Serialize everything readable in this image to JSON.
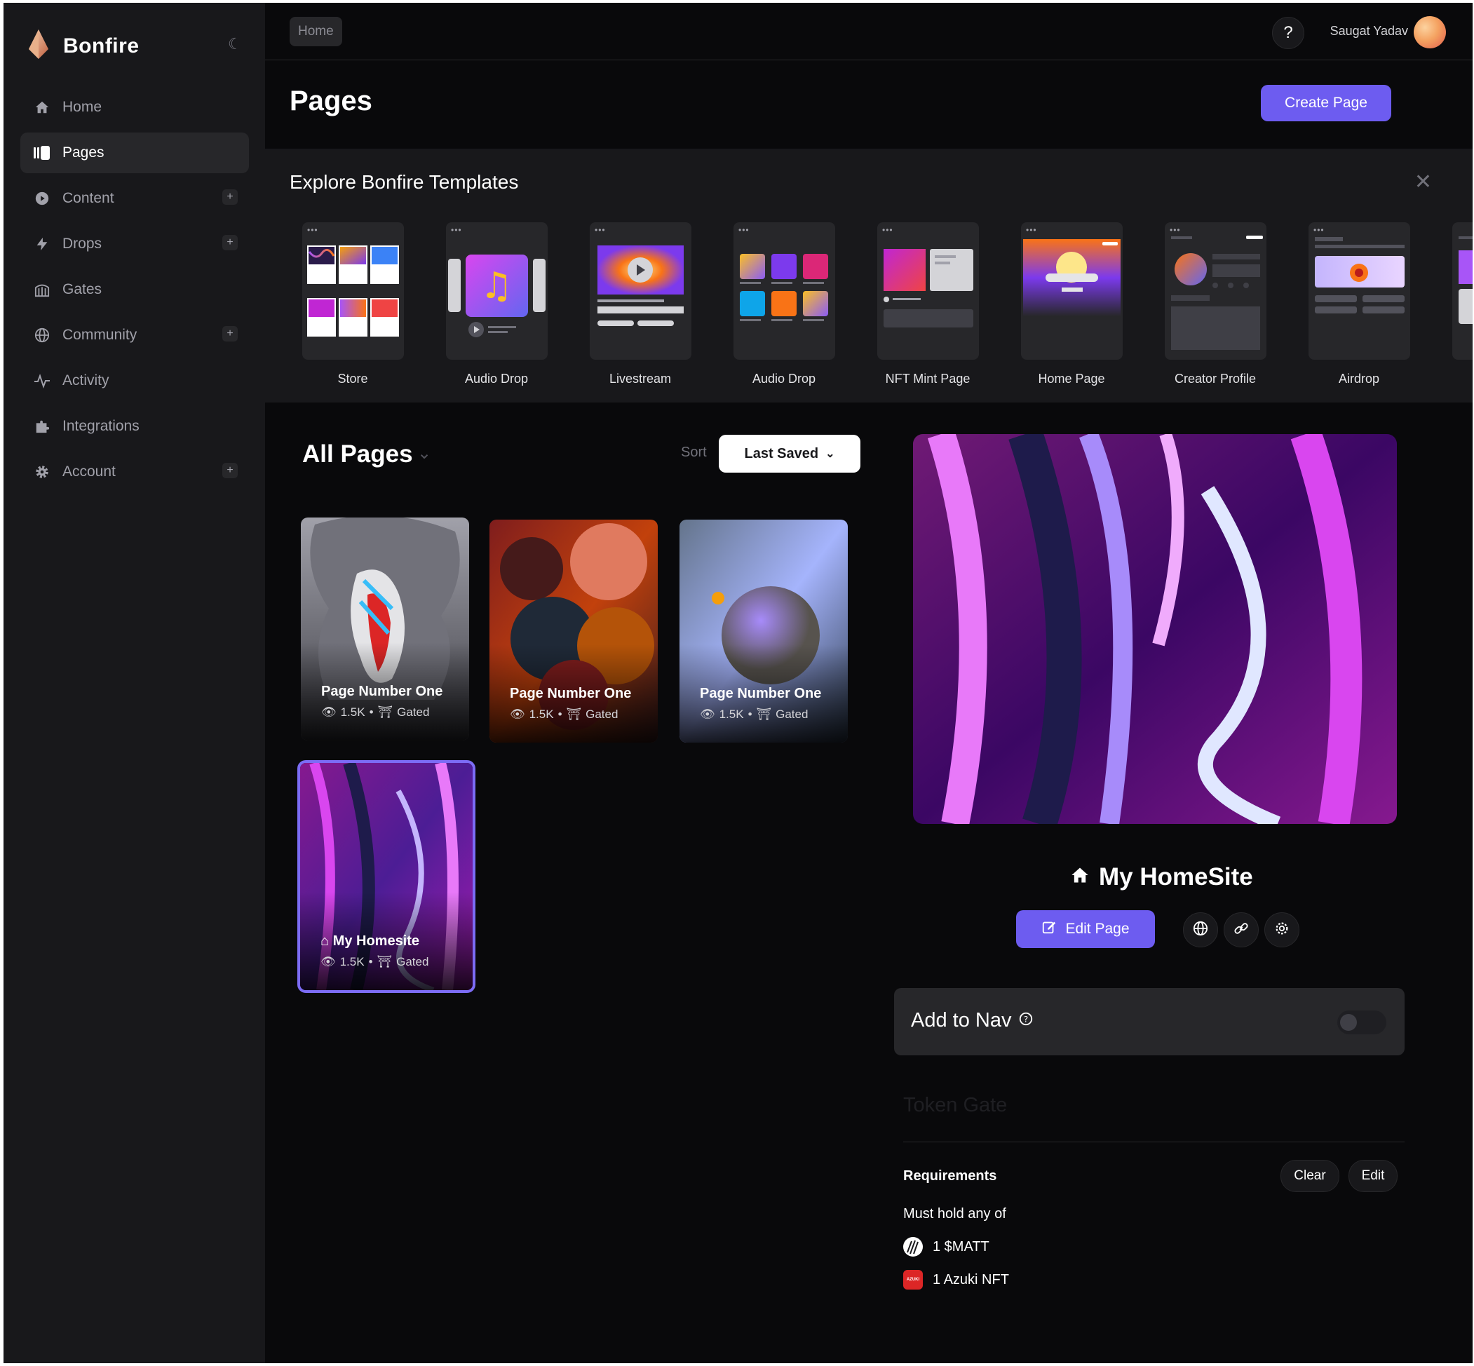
{
  "app": {
    "brand": "Bonfire"
  },
  "sidebar": {
    "items": [
      {
        "label": "Home",
        "icon": "home-icon",
        "active": false,
        "plus": false
      },
      {
        "label": "Pages",
        "icon": "pages-icon",
        "active": true,
        "plus": false
      },
      {
        "label": "Content",
        "icon": "play-circle-icon",
        "active": false,
        "plus": true
      },
      {
        "label": "Drops",
        "icon": "lightning-icon",
        "active": false,
        "plus": true
      },
      {
        "label": "Gates",
        "icon": "gate-icon",
        "active": false,
        "plus": false
      },
      {
        "label": "Community",
        "icon": "globe-icon",
        "active": false,
        "plus": true
      },
      {
        "label": "Activity",
        "icon": "activity-icon",
        "active": false,
        "plus": false
      },
      {
        "label": "Integrations",
        "icon": "puzzle-icon",
        "active": false,
        "plus": false
      },
      {
        "label": "Account",
        "icon": "gear-icon",
        "active": false,
        "plus": true
      }
    ],
    "plus_symbol": "+"
  },
  "topbar": {
    "breadcrumb": "Home",
    "help": "?",
    "user_name": "Saugat Yadav"
  },
  "header": {
    "title": "Pages",
    "create_label": "Create Page"
  },
  "templates": {
    "title": "Explore Bonfire Templates",
    "items": [
      {
        "label": "Store"
      },
      {
        "label": "Audio Drop"
      },
      {
        "label": "Livestream"
      },
      {
        "label": "Audio Drop"
      },
      {
        "label": "NFT Mint Page"
      },
      {
        "label": "Home Page"
      },
      {
        "label": "Creator Profile"
      },
      {
        "label": "Airdrop"
      }
    ]
  },
  "all_pages": {
    "title": "All Pages",
    "sort_label": "Sort",
    "sort_value": "Last Saved",
    "cards": [
      {
        "title": "Page Number One",
        "views": "1.5K",
        "status": "Gated"
      },
      {
        "title": "Page Number One",
        "views": "1.5K",
        "status": "Gated"
      },
      {
        "title": "Page Number One",
        "views": "1.5K",
        "status": "Gated"
      },
      {
        "title": "My Homesite",
        "views": "1.5K",
        "status": "Gated",
        "selected": true
      }
    ]
  },
  "detail": {
    "name": "My HomeSite",
    "edit_label": "Edit Page",
    "add_to_nav_label": "Add to Nav",
    "add_to_nav_on": false,
    "token_gate_label": "Token Gate",
    "requirements_label": "Requirements",
    "clear_label": "Clear",
    "edit_req_label": "Edit",
    "must_hold_label": "Must hold any of",
    "tokens": [
      {
        "label": "1 $MATT",
        "icon": "matt-token-icon"
      },
      {
        "label": "1 Azuki NFT",
        "icon": "azuki-icon",
        "icon_text": "AZUKI"
      }
    ]
  },
  "colors": {
    "accent": "#6d5cf0",
    "background": "#09090b",
    "sidebar": "#18181b"
  }
}
